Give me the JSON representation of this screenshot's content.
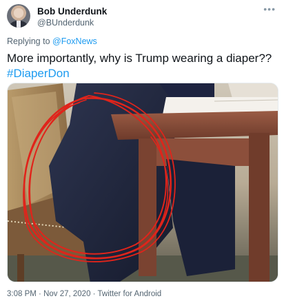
{
  "author": {
    "name": "Bob Underdunk",
    "handle": "@BUnderdunk"
  },
  "reply": {
    "prefix": "Replying to ",
    "mention": "@FoxNews"
  },
  "tweet": {
    "text": "More importantly, why is Trump wearing a diaper??",
    "hashtag": "#DiaperDon"
  },
  "meta": {
    "time": "3:08 PM",
    "date": "Nov 27, 2020",
    "source": "Twitter for Android",
    "separator": " · "
  },
  "icons": {
    "more": "more-options-icon"
  },
  "colors": {
    "link": "#1d9bf0",
    "secondary_text": "#536471",
    "annotation_circle": "#e0241b"
  }
}
